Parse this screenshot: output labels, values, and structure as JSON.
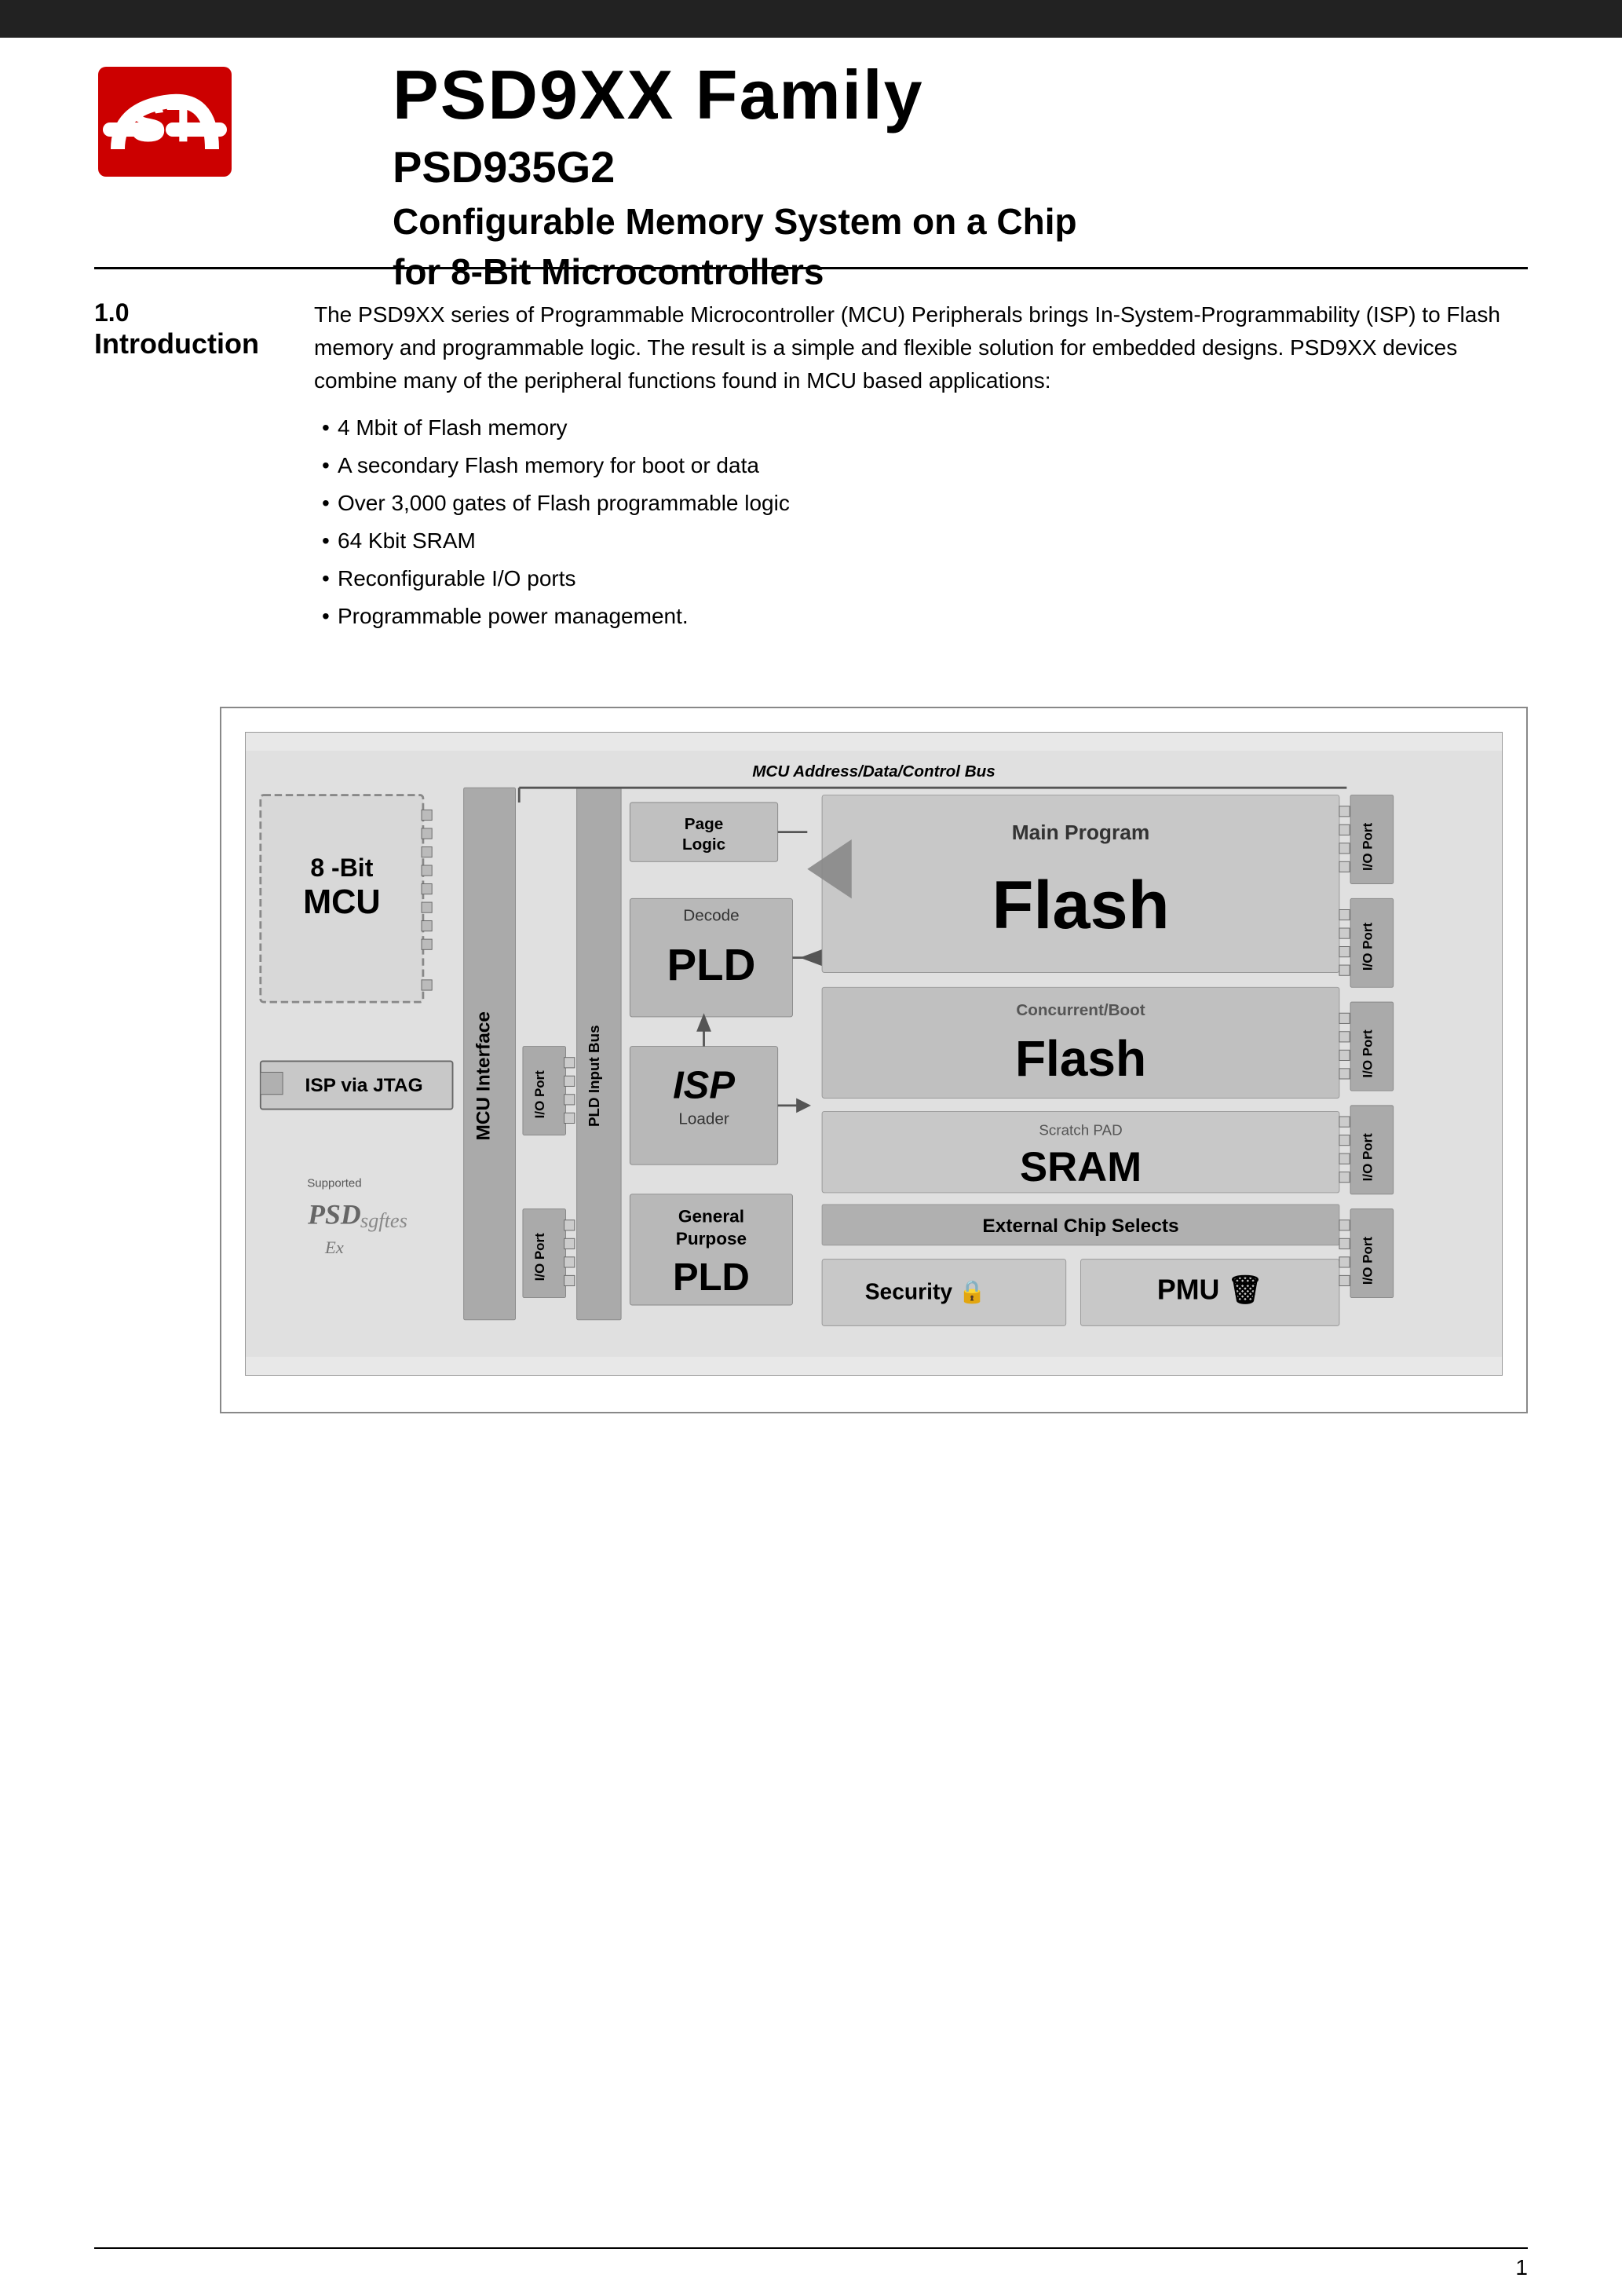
{
  "header": {
    "bar_color": "#222222"
  },
  "logo": {
    "company": "ST",
    "color": "#cc0000"
  },
  "title": {
    "main": "PSD9XX Family",
    "sub": "PSD935G2",
    "desc_line1": "Configurable Memory System on a Chip",
    "desc_line2": "for 8-Bit Microcontrollers"
  },
  "section": {
    "number": "1.0",
    "name": "Introduction"
  },
  "intro_text": {
    "paragraph": "The PSD9XX series of Programmable Microcontroller (MCU) Peripherals brings In-System-Programmability (ISP) to Flash memory and programmable logic. The result is a simple and flexible solution for embedded designs. PSD9XX devices combine many of the peripheral functions found in MCU based applications:",
    "bullets": [
      "4 Mbit of Flash memory",
      "A secondary Flash memory for boot or data",
      "Over 3,000 gates of Flash programmable logic",
      "64 Kbit SRAM",
      "Reconfigurable I/O ports",
      "Programmable power management."
    ]
  },
  "diagram": {
    "bus_label": "MCU Address/Data/Control Bus",
    "mcu_label_top": "8 -Bit",
    "mcu_label_bottom": "MCU",
    "mcu_interface": "MCU Interface",
    "isp_jtag": "ISP via JTAG",
    "page_logic": "Page Logic",
    "decode": "Decode",
    "pld_decode": "PLD",
    "isp_label": "ISP",
    "isp_sub": "Loader",
    "general_purpose": "General Purpose",
    "pld_gp": "PLD",
    "main_program": "Main Program",
    "flash_main": "Flash",
    "concurrent_boot": "Concurrent/Boot",
    "flash_boot": "Flash",
    "scratch_pad": "Scratch PAD",
    "sram": "SRAM",
    "external_chip_selects": "External Chip Selects",
    "security": "Security",
    "pmu": "PMU",
    "io_port": "I/O Port",
    "pld_input_bus": "PLD Input Bus",
    "supported": "Supported"
  },
  "footer": {
    "page_number": "1"
  }
}
